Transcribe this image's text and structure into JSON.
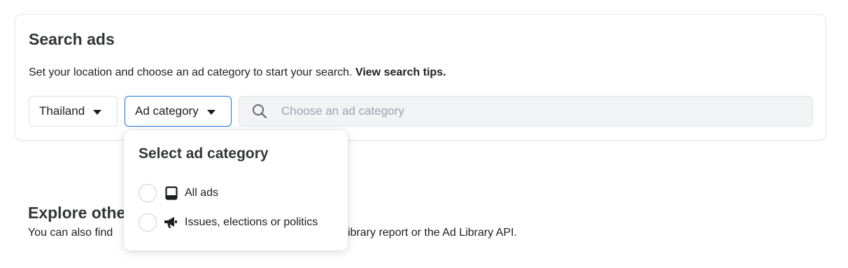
{
  "search": {
    "title": "Search ads",
    "description": "Set your location and choose an ad category to start your search.",
    "tips_link": "View search tips.",
    "country_dropdown": {
      "label": "Thailand"
    },
    "category_dropdown": {
      "label": "Ad category"
    },
    "search_input": {
      "placeholder": "Choose an ad category",
      "value": ""
    },
    "icons": {
      "search": "search-icon",
      "caret": "caret-down-icon"
    }
  },
  "category_popup": {
    "title": "Select ad category",
    "options": [
      {
        "label": "All ads",
        "icon": "tablet-icon",
        "selected": false
      },
      {
        "label": "Issues, elections or politics",
        "icon": "megaphone-icon",
        "selected": false
      }
    ]
  },
  "explore": {
    "title_visible": "Explore othe",
    "description_visible": "You can also find",
    "description_tail_visible": "ibrary report or the Ad Library API."
  },
  "colors": {
    "accent": "#1b74e4",
    "text": "#1c1e21",
    "heading": "#333538",
    "placeholder": "#9da2a9",
    "input_bg": "#f2f3f5",
    "border": "#dadde1"
  }
}
